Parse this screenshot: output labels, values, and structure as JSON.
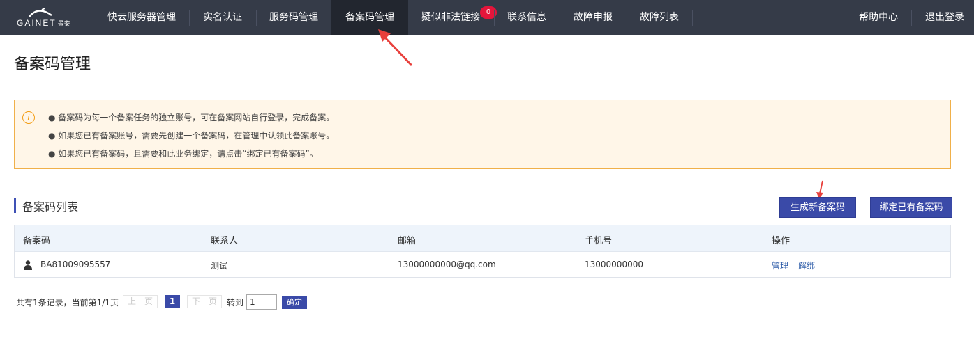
{
  "header": {
    "logo_text": "GAINET",
    "logo_sub": "景安",
    "nav": [
      {
        "label": "快云服务器管理"
      },
      {
        "label": "实名认证"
      },
      {
        "label": "服务码管理"
      },
      {
        "label": "备案码管理"
      },
      {
        "label": "疑似非法链接"
      },
      {
        "label": "联系信息"
      },
      {
        "label": "故障申报"
      },
      {
        "label": "故障列表"
      }
    ],
    "badge": "0",
    "right": [
      {
        "label": "帮助中心"
      },
      {
        "label": "退出登录"
      }
    ]
  },
  "page": {
    "title": "备案码管理"
  },
  "notice": {
    "icon": "i",
    "lines": [
      "● 备案码为每一个备案任务的独立账号，可在备案网站自行登录，完成备案。",
      "● 如果您已有备案账号，需要先创建一个备案码，在管理中认领此备案账号。",
      "● 如果您已有备案码，且需要和此业务绑定，请点击“绑定已有备案码”。"
    ]
  },
  "section": {
    "title": "备案码列表",
    "btn_new": "生成新备案码",
    "btn_bind": "绑定已有备案码"
  },
  "table": {
    "headers": [
      "备案码",
      "联系人",
      "邮箱",
      "手机号",
      "操作"
    ],
    "rows": [
      {
        "code": "BA81009095557",
        "contact": "测试",
        "email": "13000000000@qq.com",
        "phone": "13000000000",
        "actions": [
          "管理",
          "解绑"
        ]
      }
    ]
  },
  "pagination": {
    "summary": "共有1条记录，当前第1/1页",
    "prev": "上一页",
    "current": "1",
    "next": "下一页",
    "goto": "转到",
    "input_value": "1",
    "ok": "确定"
  },
  "colors": {
    "nav_bg": "#353b48",
    "nav_active": "#22262f",
    "accent": "#3a4aa8",
    "notice_bg": "#fff6e8",
    "notice_border": "#f0b04a",
    "badge": "#e4153b",
    "arrow": "#e8403c"
  }
}
